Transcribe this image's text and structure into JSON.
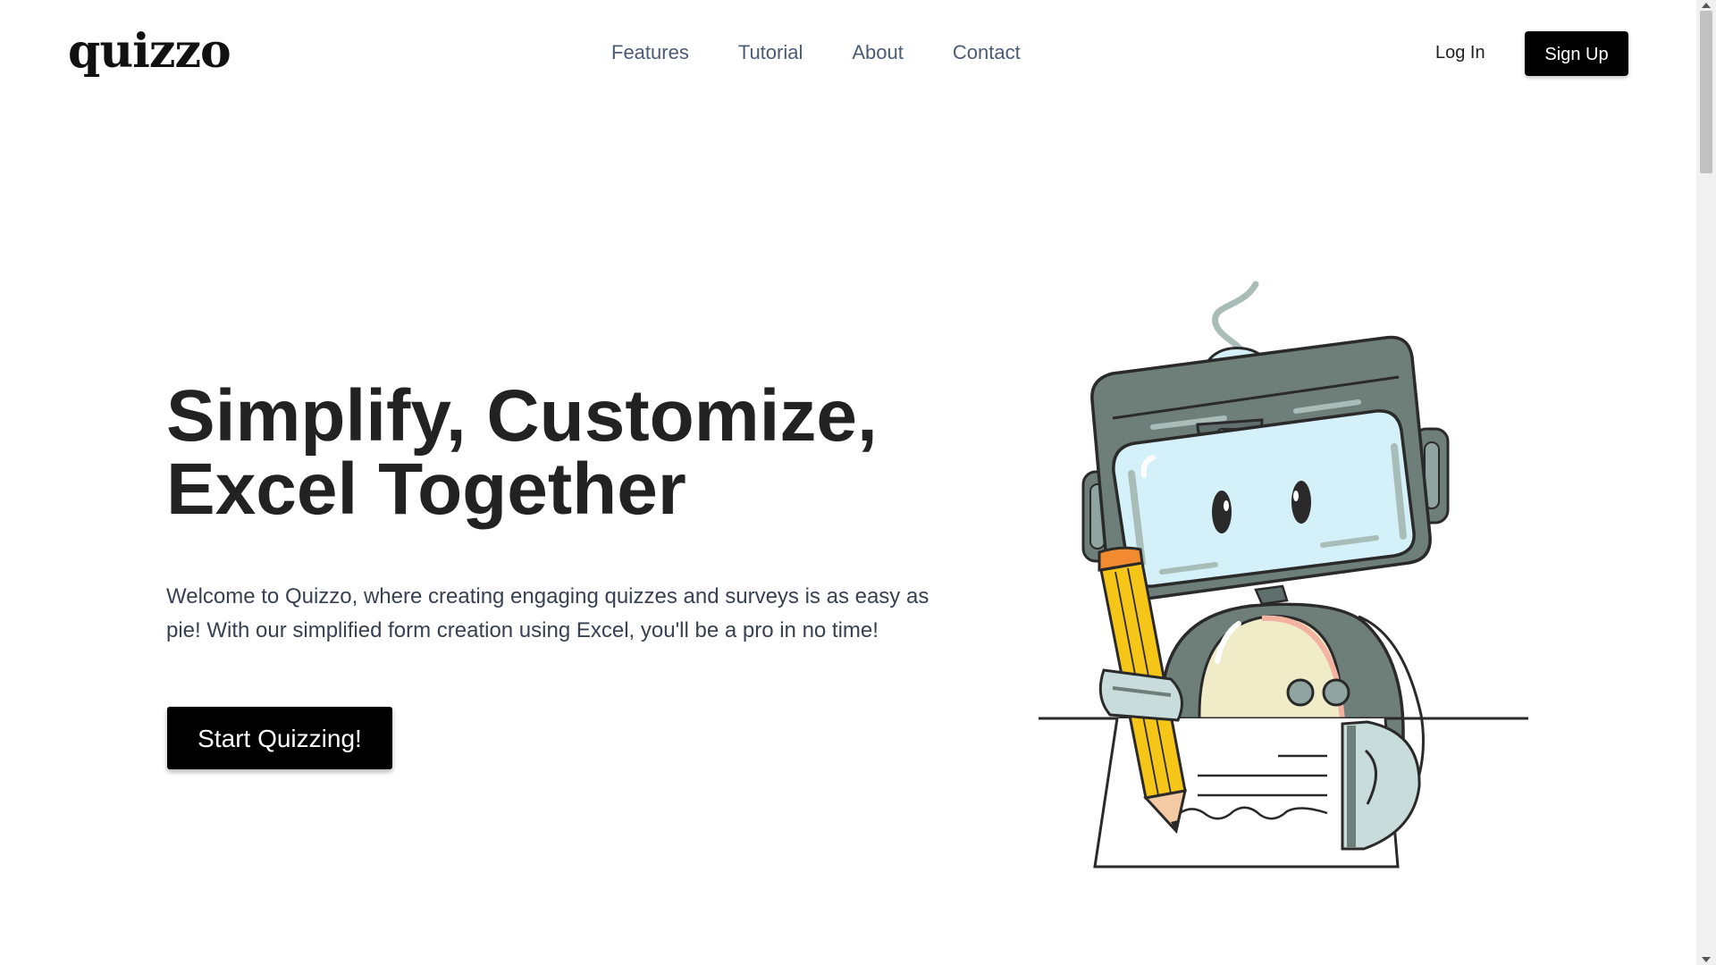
{
  "header": {
    "logo": "quizzo",
    "nav": [
      "Features",
      "Tutorial",
      "About",
      "Contact"
    ],
    "login_label": "Log In",
    "signup_label": "Sign Up"
  },
  "hero": {
    "title_line1": "Simplify, Customize,",
    "title_line2": "Excel Together",
    "description": "Welcome to Quizzo, where creating engaging quizzes and surveys is as easy as pie! With our simplified form creation using Excel, you'll be a pro in no time!",
    "cta_label": "Start Quizzing!"
  },
  "illustration": {
    "icon": "robot-writing-illustration"
  },
  "colors": {
    "nav_text": "#4b5b73",
    "button_bg": "#000000",
    "title_text": "#222222",
    "robot_body": "#6e7f7a",
    "robot_screen": "#d4f0f8",
    "pencil": "#f5c518"
  }
}
